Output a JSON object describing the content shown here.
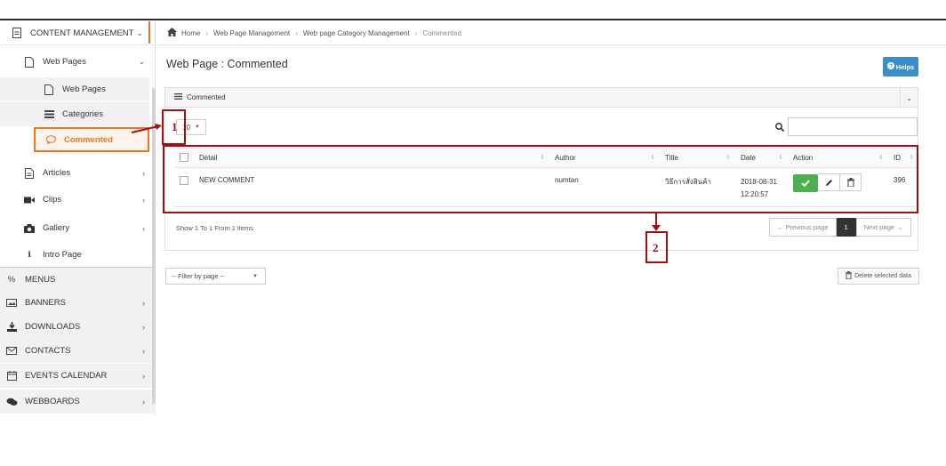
{
  "sidebar": {
    "content_management": "CONTENT MANAGEMENT",
    "web_pages": "Web Pages",
    "sub_web_pages": "Web Pages",
    "sub_categories": "Categories",
    "sub_commented": "Commented",
    "articles": "Articles",
    "clips": "Clips",
    "gallery": "Gallery",
    "intro_page": "Intro Page",
    "menus": "MENUS",
    "banners": "BANNERS",
    "downloads": "DOWNLOADS",
    "contacts": "CONTACTS",
    "events_calendar": "EVENTS CALENDAR",
    "webboards": "WEBBOARDS"
  },
  "breadcrumb": [
    "Home",
    "Web Page Management",
    "Web page Category Management",
    "Commented"
  ],
  "page_title": "Web Page : Commented",
  "helps_label": "Helps",
  "panel_title": "Commented",
  "page_size": "10",
  "table": {
    "headers": [
      "Detail",
      "Author",
      "Title",
      "Date",
      "Action",
      "ID"
    ],
    "rows": [
      {
        "detail": "NEW COMMENT",
        "author": "numtan",
        "title": "วิธีการสั่งสินค้า",
        "date": "2018-08-31",
        "time": "12:20:57",
        "id": "396"
      }
    ]
  },
  "table_footer": "Show 1 To 1 From 1 items",
  "pager": {
    "prev": "← Previous page",
    "current": "1",
    "next": "Next page →"
  },
  "filter_placeholder": "-- Filter by page --",
  "delete_label": "Delete selected data",
  "annotations": {
    "one": "1",
    "two": "2"
  },
  "colors": {
    "accent_orange": "#e87722",
    "annotation_red": "#a01010",
    "helps_blue": "#3a8fc7",
    "ok_green": "#4caf50"
  }
}
